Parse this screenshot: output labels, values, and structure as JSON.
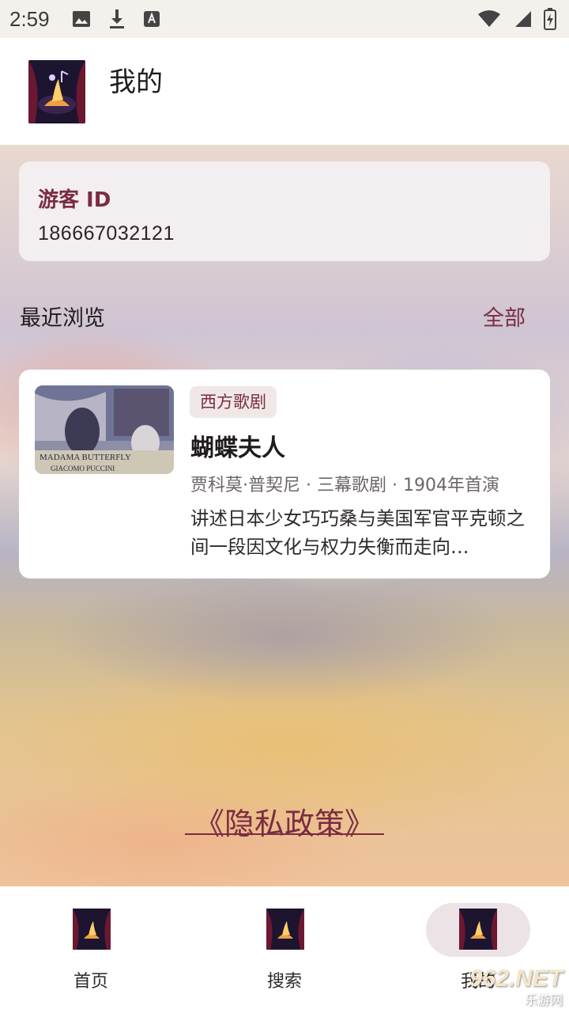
{
  "status_bar": {
    "time": "2:59",
    "icons": [
      "image-icon",
      "download-icon",
      "a-icon",
      "wifi-icon",
      "signal-icon",
      "battery-charging-icon"
    ]
  },
  "app_bar": {
    "title": "我的",
    "logo": "opera-theater-logo"
  },
  "guest_card": {
    "label": "游客 ID",
    "value": "186667032121"
  },
  "recent": {
    "title": "最近浏览",
    "all_label": "全部",
    "items": [
      {
        "category": "西方歌剧",
        "title": "蝴蝶夫人",
        "meta": "贾科莫·普契尼 · 三幕歌剧 · 1904年首演",
        "description": "讲述日本少女巧巧桑与美国军官平克顿之间一段因文化与权力失衡而走向…",
        "poster_text": "MADAMA BUTTERFLY · GIACOMO PUCCINI"
      }
    ]
  },
  "privacy_link": "《隐私政策》",
  "bottom_nav": {
    "items": [
      {
        "label": "首页",
        "icon": "home-logo-icon",
        "active": false
      },
      {
        "label": "搜索",
        "icon": "search-logo-icon",
        "active": false
      },
      {
        "label": "我的",
        "icon": "profile-logo-icon",
        "active": true
      }
    ]
  },
  "watermark": {
    "main": "962.NET",
    "sub": "乐游网"
  },
  "colors": {
    "accent": "#7a2c42",
    "card_bg": "#f3eef0",
    "chip_bg": "#f0e8e6",
    "active_pill": "#ece3e6"
  }
}
